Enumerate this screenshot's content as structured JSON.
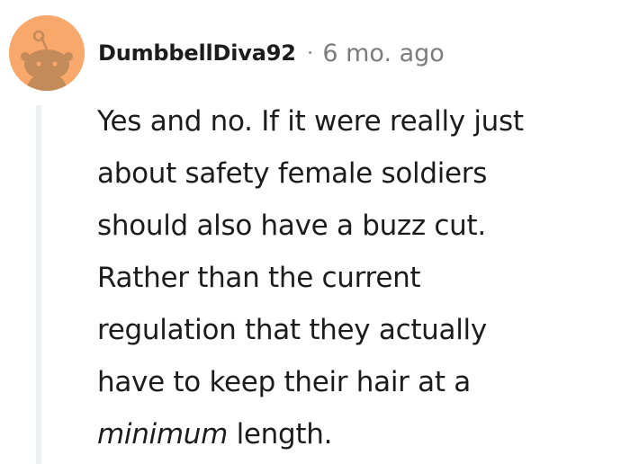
{
  "comment": {
    "avatar_icon": "reddit-snoo-avatar-icon",
    "avatar_color": "#f8a86a",
    "username": "DumbbellDiva92",
    "separator": "·",
    "timestamp": "6 mo. ago",
    "body": {
      "line1": "Yes and no. If it were really just",
      "line2": "about safety female soldiers",
      "line3": "should also have a buzz cut.",
      "line4": "Rather than the current",
      "line5": "regulation that they actually",
      "line6": "have to keep their hair at a",
      "emphasis": "minimum",
      "line7_rest": " length."
    }
  }
}
